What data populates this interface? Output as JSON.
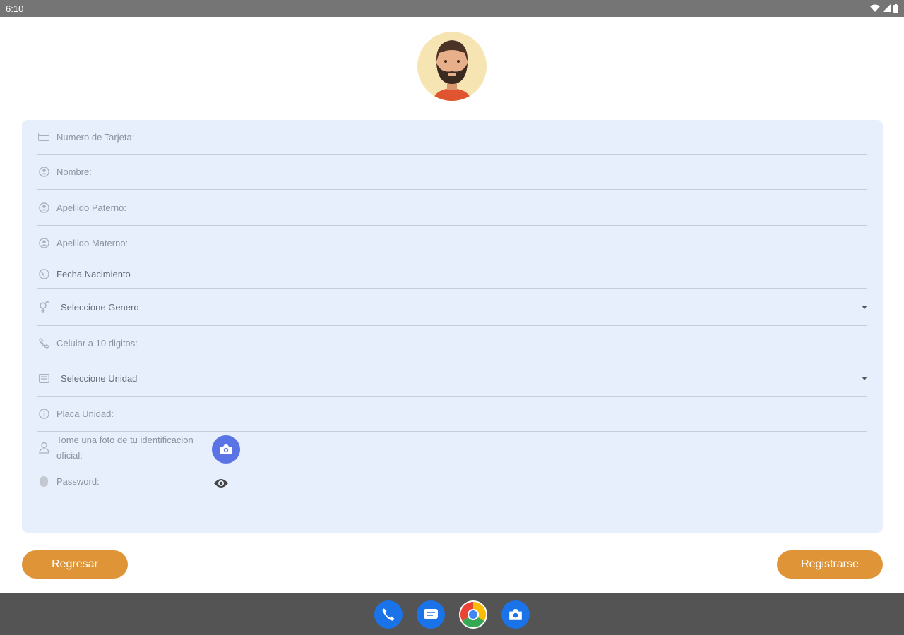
{
  "status_bar": {
    "time": "6:10"
  },
  "form": {
    "card_number_label": "Numero de Tarjeta:",
    "name_label": "Nombre:",
    "paternal_label": "Apellido Paterno:",
    "maternal_label": "Apellido Materno:",
    "birthdate_label": "Fecha Nacimiento",
    "gender_select": "Seleccione Genero",
    "phone_label": "Celular a 10 digitos:",
    "unit_select": "Seleccione Unidad",
    "plate_label": "Placa Unidad:",
    "photo_label": "Tome una foto de tu identificacion oficial:",
    "password_label": "Password:"
  },
  "actions": {
    "back_label": "Regresar",
    "register_label": "Registrarse"
  },
  "colors": {
    "accent": "#de9437",
    "card_bg": "#e7effd",
    "camera_button": "#5a74e6"
  },
  "nav_apps": [
    "phone-icon",
    "messages-icon",
    "chrome-icon",
    "camera-icon"
  ]
}
